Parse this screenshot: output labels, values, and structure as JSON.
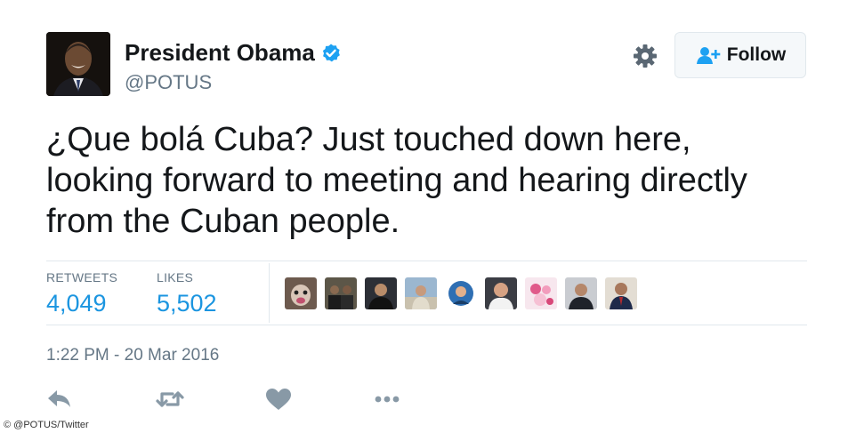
{
  "author": {
    "name": "President Obama",
    "handle": "@POTUS",
    "verified": true
  },
  "follow_button": {
    "label": "Follow",
    "icon": "add-user-icon"
  },
  "settings_icon": "gear-icon",
  "tweet": {
    "text": "¿Que bolá Cuba? Just touched down here,\nlooking forward to meeting and hearing directly\nfrom the Cuban people."
  },
  "stats": {
    "retweets": {
      "label": "RETWEETS",
      "value": "4,049"
    },
    "likes": {
      "label": "LIKES",
      "value": "5,502"
    }
  },
  "likers_count_shown": 9,
  "timestamp": "1:22 PM - 20 Mar 2016",
  "actions": [
    "reply-icon",
    "retweet-icon",
    "like-icon",
    "more-icon"
  ],
  "colors": {
    "link_blue": "#1b95e0",
    "secondary_text": "#657786",
    "verified_blue": "#1da1f2",
    "icon_gray": "#8899a6"
  },
  "photo_credit": "© @POTUS/Twitter"
}
